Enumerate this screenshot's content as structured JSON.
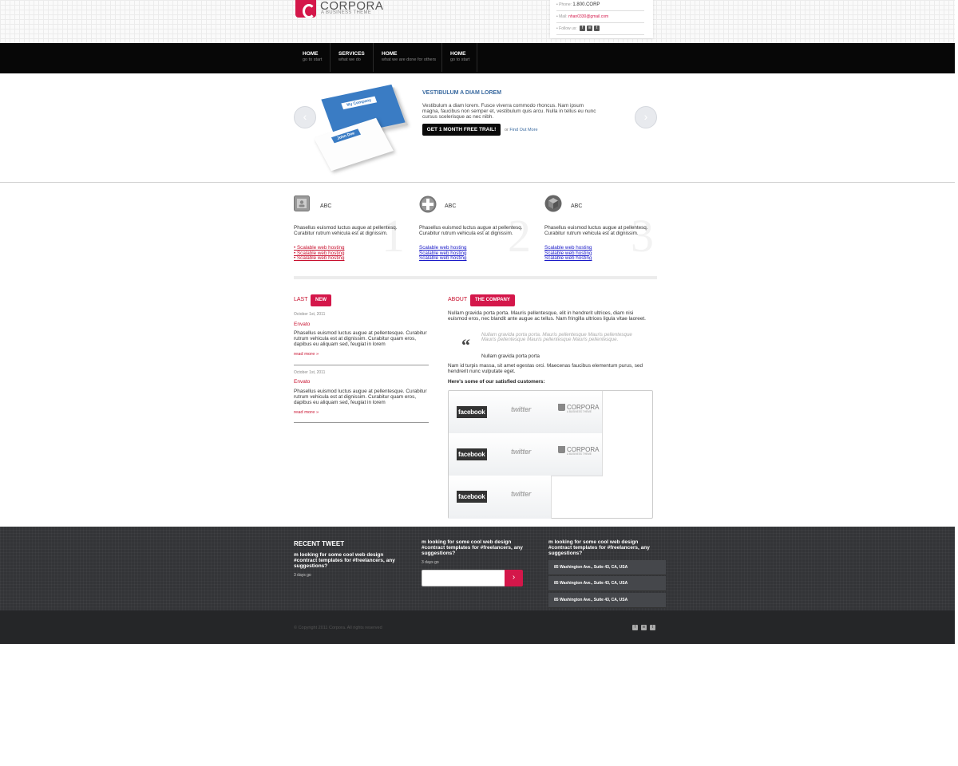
{
  "header": {
    "logo_name": "CORPORA",
    "logo_tagline": "A BUSINESS THEME",
    "contact": {
      "phone_label": "Phone:",
      "phone_value": "1.800.CORP",
      "mail_label": "Mail:",
      "mail_value": "nhan0330@gmail.com",
      "follow_label": "Follow us:"
    }
  },
  "nav": {
    "items": [
      {
        "title": "HOME",
        "sub": "go to start"
      },
      {
        "title": "SERVICES",
        "sub": "what we do"
      },
      {
        "title": "HOME",
        "sub": "what we are done for others"
      },
      {
        "title": "HOME",
        "sub": "go to start"
      }
    ]
  },
  "slider": {
    "card_back_label": "My Company",
    "card_front_label": "John Doe",
    "title": "VESTIBULUM A DIAM LOREM",
    "text": "Vestibulum a diam lorem. Fusce viverra commodo rhoncus. Nam ipsum magna, faucibus non semper et, vestibulum quis arcu. Nulla in tellus eu nunc cursus scelerisque ac nec nibh.",
    "button_label": "GET 1 MONTH FREE TRAIL!",
    "link_prefix": "or",
    "link_label": "Find Out More",
    "prev_icon": "arrow-left-icon",
    "next_icon": "arrow-right-icon"
  },
  "features": [
    {
      "title": "ABC",
      "number": "1",
      "text": "Phasellus euismod luctus augue at pellentesq. Curabitur rutrum vehicula est at dignissim.",
      "links": [
        "Scalable web hosting",
        "Scalable web hosting",
        "Scalable web hosting"
      ]
    },
    {
      "title": "ABC",
      "number": "2",
      "text": "Phasellus euismod luctus augue at pellentesq. Curabitur rutrum vehicula est at dignissim.",
      "links": [
        "Scalable web hosting",
        "Scalable web hosting",
        "Scalable web hosting"
      ]
    },
    {
      "title": "ABC",
      "number": "3",
      "text": "Phasellus euismod luctus augue at pellentesq. Curabitur rutrum vehicula est at dignissim.",
      "links": [
        "Scalable web hosting",
        "Scalable web hosting",
        "Scalable web hosting"
      ]
    }
  ],
  "news": {
    "title": "LAST",
    "badge": "NEW",
    "items": [
      {
        "date": "October 1st, 2011",
        "author": "Envato",
        "text": "Phasellus euismod luctus augue at pellentesque. Curabitur rutrum vehicula est at dignissim. Curabitur quam eros, dapibus eu aliquam sed, feugiat in lorem",
        "more": "read more »"
      },
      {
        "date": "October 1st, 2011",
        "author": "Envato",
        "text": "Phasellus euismod luctus augue at pellentesque. Curabitur rutrum vehicula est at dignissim. Curabitur quam eros, dapibus eu aliquam sed, feugiat in lorem",
        "more": "read more »"
      }
    ]
  },
  "about": {
    "title": "ABOUT",
    "badge": "THE COMPANY",
    "text1": "Nullam gravida porta porta. Mauris pellentesque, elit in hendrerit ultrices, diam nisi euismod eros, nec blandit ante augue ac tellus. Nam fringilla ultrices ligula vitae laoreet.",
    "quote": "Nullam gravida porta porta. Mauris pellentesque Mauris pellentesque Mauris pellentesque Mauris pellentesque Mauris pellentesque.",
    "quote_author": "Nullam gravida porta porta",
    "text2": "Nam id turpis massa, sit amet egestas orci. Maecenas faucibus elementum purus, sed hendrerit nunc vulputate eget.",
    "customers_title": "Here's some of our satisfied customers:",
    "clients": [
      [
        "facebook",
        "twitter",
        "CORPORA"
      ],
      [
        "facebook",
        "twitter",
        "CORPORA"
      ],
      [
        "facebook",
        "twitter"
      ]
    ],
    "client_tagline": "A BUSINESS THEME"
  },
  "footer": {
    "recent_tweet_title": "RECENT TWEET",
    "tweets": [
      {
        "text": "m looking for some cool web design #contract templates for #freelancers, any suggestions?",
        "age": "3 days go"
      },
      {
        "text": "m looking for some cool web design #contract templates for #freelancers, any suggestions?",
        "age": "3 days go"
      },
      {
        "text": "m looking for some cool web design #contract templates for #freelancers, any suggestions?"
      }
    ],
    "addresses": [
      "85 Washington Ave., Suite 43, CA, USA",
      "85 Washington Ave., Suite 43, CA, USA",
      "85 Washington Ave., Suite 43, CA, USA"
    ],
    "copyright": "© Copyright 2011 Corpora. All rights reserved",
    "newsletter_button": "›"
  },
  "colors": {
    "accent": "#d4174a",
    "nav_bg": "#070707",
    "footer_bg": "#333437",
    "link_blue": "#3a6aa0"
  }
}
